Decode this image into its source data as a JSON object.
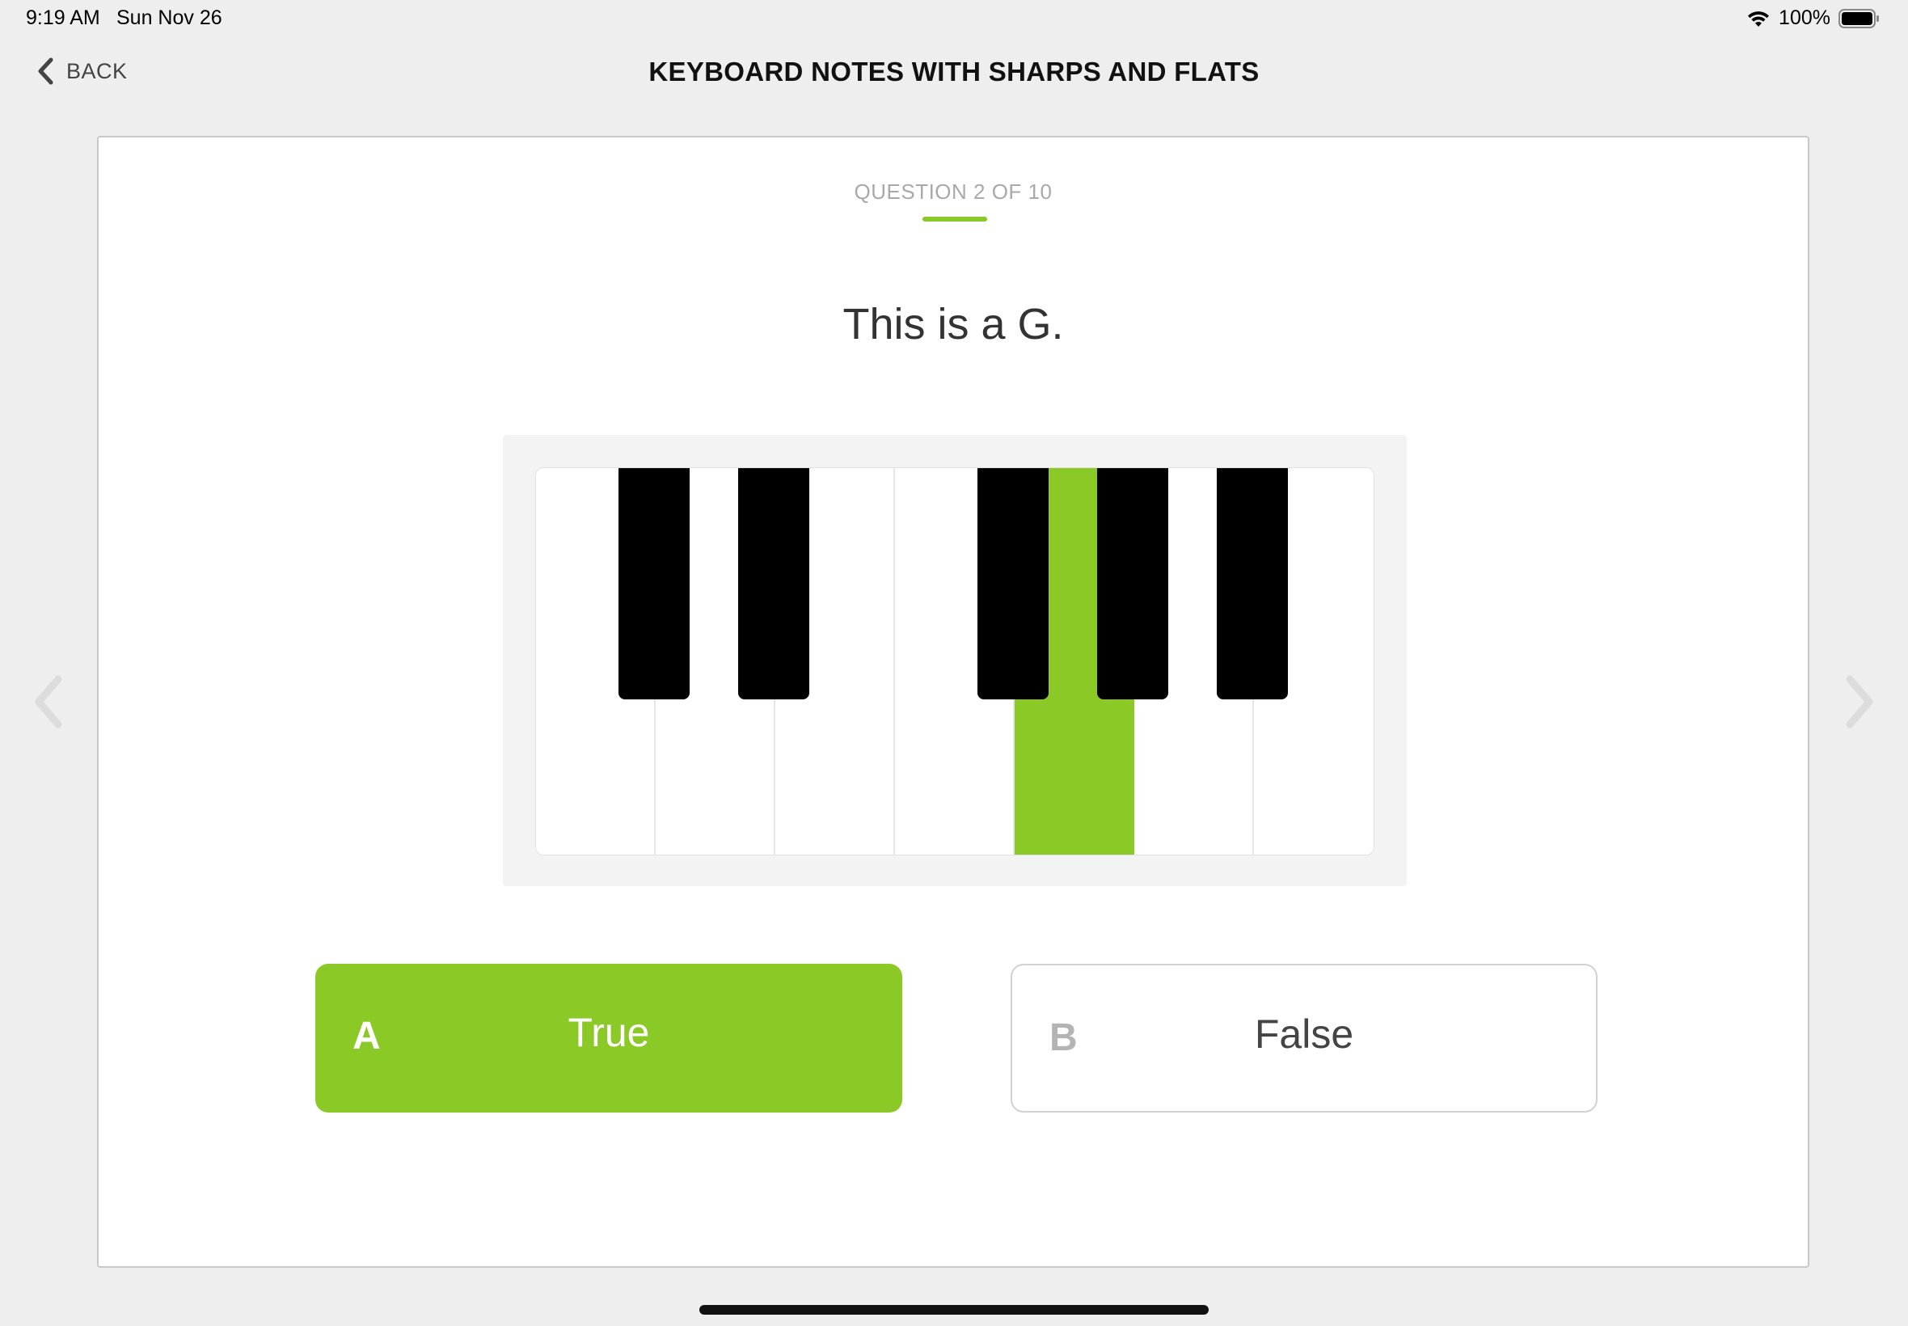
{
  "status_bar": {
    "time": "9:19 AM",
    "date": "Sun Nov 26",
    "battery_percent": "100%",
    "wifi_icon": "wifi-icon",
    "battery_icon": "battery-icon"
  },
  "nav": {
    "back_label": "BACK",
    "back_icon": "chevron-left-icon",
    "title": "KEYBOARD NOTES WITH SHARPS AND FLATS"
  },
  "quiz": {
    "question_counter": "QUESTION 2 OF 10",
    "question_text": "This is a G.",
    "keyboard": {
      "white_key_count": 7,
      "highlighted_white_key_index": 4,
      "highlight_color": "#8bc926"
    },
    "answers": [
      {
        "letter": "A",
        "label": "True",
        "selected": true
      },
      {
        "letter": "B",
        "label": "False",
        "selected": false
      }
    ]
  },
  "navigation_arrows": {
    "previous_icon": "chevron-left-icon",
    "next_icon": "chevron-right-icon"
  },
  "colors": {
    "accent": "#8bc926",
    "background": "#eeeeee",
    "card": "#ffffff"
  }
}
